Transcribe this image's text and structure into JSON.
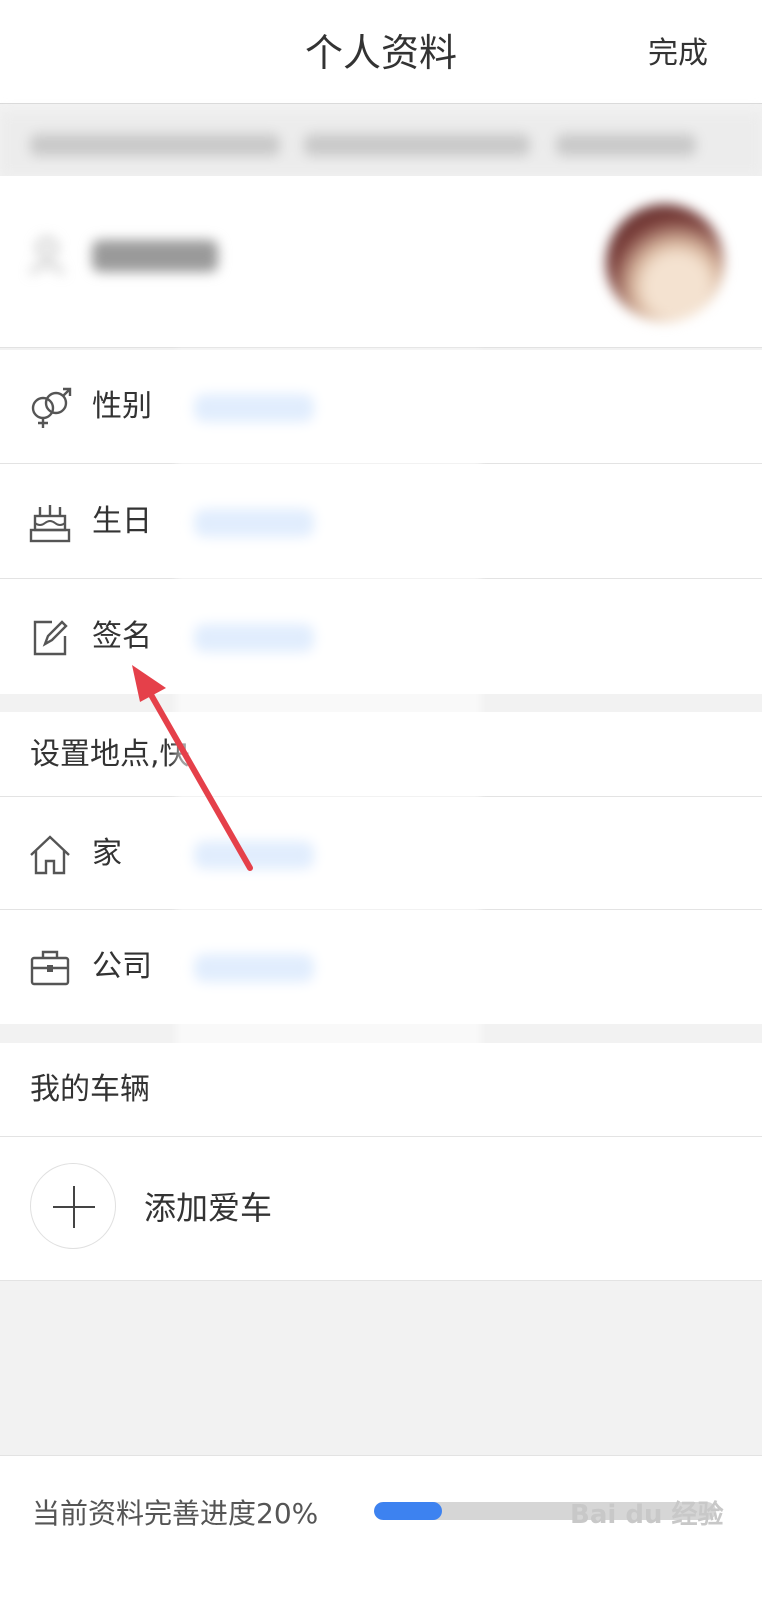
{
  "header": {
    "title": "个人资料",
    "done_label": "完成"
  },
  "profile": {
    "avatar_icon": "avatar-photo",
    "name_icon": "person-icon"
  },
  "basic_rows": [
    {
      "label": "性别",
      "icon": "gender-icon"
    },
    {
      "label": "生日",
      "icon": "cake-icon"
    },
    {
      "label": "签名",
      "icon": "edit-icon"
    }
  ],
  "location_section": {
    "title": "设置地点,快"
  },
  "location_rows": [
    {
      "label": "家",
      "icon": "home-icon"
    },
    {
      "label": "公司",
      "icon": "briefcase-icon"
    }
  ],
  "vehicle_section": {
    "title": "我的车辆",
    "add_label": "添加爱车"
  },
  "footer": {
    "progress_text": "当前资料完善进度20%",
    "progress_percent": 20,
    "watermark": "Bai du 经验"
  },
  "colors": {
    "accent": "#3d82f0",
    "annotation_arrow": "#e5404a",
    "background": "#f2f2f2"
  }
}
